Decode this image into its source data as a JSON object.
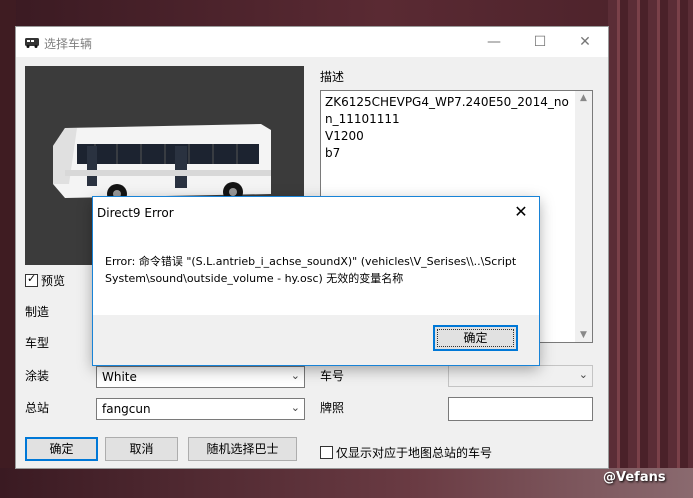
{
  "window": {
    "title": "选择车辆",
    "min_glyph": "—",
    "max_glyph": "☐",
    "close_glyph": "✕"
  },
  "description": {
    "label": "描述",
    "text": "ZK6125CHEVPG4_WP7.240E50_2014_non_11101111\nV1200\nb7"
  },
  "preview_checkbox": {
    "label": "预览",
    "checked": true
  },
  "fields": {
    "manufacturer_label": "制造",
    "model_label": "车型",
    "livery_label": "涂装",
    "livery_value": "White",
    "depot_label": "总站",
    "depot_value": "fangcun",
    "number_label": "车号",
    "number_value": "",
    "plate_label": "牌照",
    "plate_value": ""
  },
  "buttons": {
    "ok": "确定",
    "cancel": "取消",
    "random": "随机选择巴士"
  },
  "filter_checkbox": {
    "label": "仅显示对应于地图总站的车号",
    "checked": false
  },
  "error_dialog": {
    "title": "Direct9 Error",
    "message": "Error: 命令错误 \"(S.L.antrieb_i_achse_soundX)\" (vehicles\\V_Serises\\\\..\\Script System\\sound\\outside_volume - hy.osc) 无效的变量名称",
    "ok": "确定",
    "close_glyph": "✕"
  },
  "watermark": "@Vefans",
  "icons": {
    "dropdown": "chevron-down-icon",
    "bus_preview": "bus-icon",
    "app": "bus-app-icon"
  }
}
